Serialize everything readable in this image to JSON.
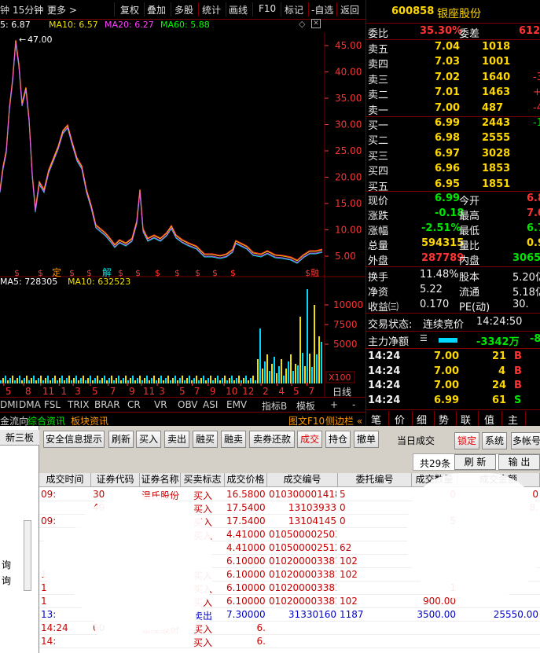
{
  "toolbar": {
    "period_label": "15分钟",
    "more_label": "更多 >",
    "restore_label": "复权",
    "overlay_label": "叠加",
    "multi_label": "多股",
    "stats_label": "统计",
    "draw_label": "画线",
    "f10_label": "F10",
    "mark_label": "标记",
    "watchlist_label": "-自选",
    "back_label": "返回"
  },
  "ma_line": {
    "ma5": "5: 6.87",
    "ma10": "MA10: 6.57",
    "ma20": "MA20: 6.27",
    "ma60": "MA60: 5.88",
    "peak_label": "47.00",
    "prefix": "钟"
  },
  "price_axis": [
    "45.00",
    "40.00",
    "35.00",
    "30.00",
    "25.00",
    "20.00",
    "15.00",
    "10.00",
    "5.00"
  ],
  "event_markers": {
    "ding": "定",
    "jie": "解",
    "rongquan": "融",
    "s": "$"
  },
  "volume": {
    "ma5": "MA5: 728305",
    "ma10": "MA10: 632523",
    "axis": [
      "10000",
      "7500",
      "5000"
    ],
    "unit": "X100"
  },
  "time_axis": [
    "5",
    "8",
    "11",
    "1",
    "3",
    "5",
    "7",
    "9",
    "11",
    "3",
    "5",
    "7",
    "9",
    "10",
    "12",
    "2",
    "4",
    "5",
    "7",
    "9"
  ],
  "daily_label": "日线",
  "indicator_tabs": [
    "DMI",
    "DMA",
    "FSL",
    "TRIX",
    "BRAR",
    "CR",
    "VR",
    "OBV",
    "ASI",
    "EMV"
  ],
  "indicator_extra": {
    "plus": "+",
    "minus": "-",
    "index_b": "指标B",
    "template": "模板"
  },
  "info_tabs": [
    "金流向",
    "综合资讯",
    "板块资讯"
  ],
  "side_tabs": [
    "图文F10",
    "侧边栏 «"
  ],
  "quote_tabs": [
    "笔",
    "价",
    "细",
    "势",
    "联",
    "值",
    "主"
  ],
  "quote": {
    "code": "600858",
    "name": "银座股份",
    "weibi_label": "委比",
    "weibi": "35.30%",
    "weicha_label": "委差",
    "weicha": "612",
    "asks": [
      {
        "label": "卖五",
        "price": "7.04",
        "vol": "1018",
        "chg": ""
      },
      {
        "label": "卖四",
        "price": "7.03",
        "vol": "1001",
        "chg": ""
      },
      {
        "label": "卖三",
        "price": "7.02",
        "vol": "1640",
        "chg": "-3"
      },
      {
        "label": "卖二",
        "price": "7.01",
        "vol": "1463",
        "chg": "+7"
      },
      {
        "label": "卖一",
        "price": "7.00",
        "vol": "487",
        "chg": "-4"
      }
    ],
    "bids": [
      {
        "label": "买一",
        "price": "6.99",
        "vol": "2443",
        "chg": "-1"
      },
      {
        "label": "买二",
        "price": "6.98",
        "vol": "2555",
        "chg": ""
      },
      {
        "label": "买三",
        "price": "6.97",
        "vol": "3028",
        "chg": ""
      },
      {
        "label": "买四",
        "price": "6.96",
        "vol": "1853",
        "chg": ""
      },
      {
        "label": "买五",
        "price": "6.95",
        "vol": "1851",
        "chg": ""
      }
    ],
    "stats": [
      {
        "l1": "现价",
        "v1": "6.99",
        "l2": "今开",
        "v2": "6.8",
        "c1": "green",
        "c2": "red"
      },
      {
        "l1": "涨跌",
        "v1": "-0.18",
        "l2": "最高",
        "v2": "7.0",
        "c1": "green",
        "c2": "red"
      },
      {
        "l1": "涨幅",
        "v1": "-2.51%",
        "l2": "最低",
        "v2": "6.7",
        "c1": "green",
        "c2": "green"
      },
      {
        "l1": "总量",
        "v1": "594315",
        "l2": "量比",
        "v2": "0.9",
        "c1": "yellow",
        "c2": "yellow"
      },
      {
        "l1": "外盘",
        "v1": "287789",
        "l2": "内盘",
        "v2": "30652",
        "c1": "red",
        "c2": "green"
      }
    ],
    "stats2": [
      {
        "l1": "换手",
        "v1": "11.48%",
        "l2": "股本",
        "v2": "5.20亿"
      },
      {
        "l1": "净资",
        "v1": "5.22",
        "l2": "流通",
        "v2": "5.18亿"
      },
      {
        "l1": "收益㈢",
        "v1": "0.170",
        "l2": "PE(动)",
        "v2": "30."
      }
    ],
    "trade_status_label": "交易状态:",
    "trade_status": "连续竞价",
    "trade_time": "14:24:50",
    "main_net_label": "主力净额",
    "main_net": "-3342万",
    "main_net_pct": "-8",
    "ticks": [
      {
        "time": "14:24",
        "price": "7.00",
        "vol": "21",
        "bs": "B"
      },
      {
        "time": "14:24",
        "price": "7.00",
        "vol": "4",
        "bs": "B"
      },
      {
        "time": "14:24",
        "price": "7.00",
        "vol": "24",
        "bs": "B"
      },
      {
        "time": "14:24",
        "price": "6.99",
        "vol": "61",
        "bs": "S"
      }
    ]
  },
  "bottom": {
    "left_tab": "新三板",
    "left_items": [
      "询",
      "询"
    ],
    "buttons": [
      "安全信息提示",
      "刷新",
      "买入",
      "卖出",
      "融买",
      "融卖",
      "卖券还款",
      "成交",
      "持仓",
      "撤单"
    ],
    "today_trades": "当日成交",
    "lock": "锁定",
    "system": "系统",
    "multi_account": "多帐号",
    "count": "共29条",
    "refresh": "刷 新",
    "export": "输 出",
    "columns": [
      "成交时间",
      "证券代码",
      "证券名称",
      "买卖标志",
      "成交价格",
      "成交编号",
      "委托编号",
      "成交数量",
      "成交金额"
    ],
    "rows": [
      {
        "time": "09:",
        "code": "30",
        "name": "温氏股份",
        "flag": "买入",
        "price": "16.58000000",
        "no": "0103000014186939",
        "order": "5",
        "qty": "0",
        "amt": "0",
        "color": "red"
      },
      {
        "time": "",
        "code": "49",
        "name": "",
        "flag": "买入",
        "price": "17.54000000",
        "no": "13103933",
        "order": "0",
        "qty": "",
        "amt": "8.",
        "color": "red"
      },
      {
        "time": "09:",
        "code": "",
        "name": "",
        "flag": "买入",
        "price": "17.54000000",
        "no": "13104145",
        "order": "0",
        "qty": "5",
        "amt": "",
        "color": "red"
      },
      {
        "time": "",
        "code": "",
        "name": "",
        "flag": "买入",
        "price": "4.41000000",
        "no": "0105000025037620",
        "order": "",
        "qty": "",
        "amt": "",
        "color": "red"
      },
      {
        "time": "",
        "code": "",
        "name": "",
        "flag": "",
        "price": "4.41000000",
        "no": "0105000025127899",
        "order": "62",
        "qty": "",
        "amt": "",
        "color": "red"
      },
      {
        "time": "",
        "code": "",
        "name": "",
        "flag": "",
        "price": "6.10000000",
        "no": "0102000033816859",
        "order": "102",
        "qty": "",
        "amt": "",
        "color": "red"
      },
      {
        "time": "1",
        "code": "",
        "name": "",
        "flag": "买入",
        "price": "6.10000000",
        "no": "0102000033816861",
        "order": "102",
        "qty": "",
        "amt": "",
        "color": "red"
      },
      {
        "time": "1",
        "code": "",
        "name": "",
        "flag": "买入",
        "price": "6.10000000",
        "no": "0102000033816863",
        "order": "",
        "qty": "1",
        "amt": "",
        "color": "red"
      },
      {
        "time": "1",
        "code": "",
        "name": "",
        "flag": "买入",
        "price": "6.10000000",
        "no": "0102000033816865",
        "order": "102",
        "qty": "900.00",
        "amt": "",
        "color": "red"
      },
      {
        "time": "13:",
        "code": "",
        "name": "",
        "flag": "卖出",
        "price": "7.30000000",
        "no": "31330160",
        "order": "1187",
        "qty": "3500.00",
        "amt": "25550.00",
        "color": "blue"
      },
      {
        "time": "14:24",
        "code": "60",
        "name": "银座股份",
        "flag": "买入",
        "price": "6.",
        "no": "",
        "order": "",
        "qty": "",
        "amt": "",
        "color": "red"
      },
      {
        "time": "14:",
        "code": "",
        "name": "",
        "flag": "买入",
        "price": "6.",
        "no": "",
        "order": "",
        "qty": "",
        "amt": "",
        "color": "red"
      }
    ]
  }
}
